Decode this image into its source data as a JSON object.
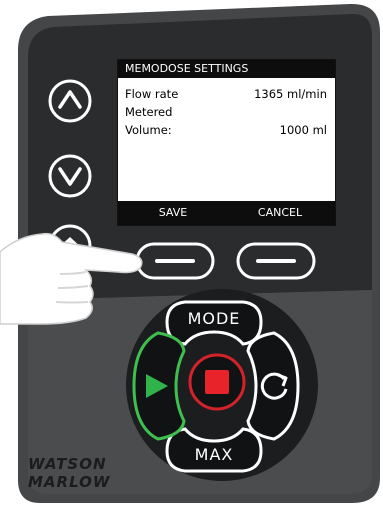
{
  "screen": {
    "title": "MEMODOSE SETTINGS",
    "rows": [
      {
        "label": "Flow rate",
        "value": "1365 ml/min"
      },
      {
        "label": "Metered",
        "value": ""
      },
      {
        "label": "Volume:",
        "value": "1000 ml"
      }
    ],
    "softkeys": {
      "left": "SAVE",
      "right": "CANCEL"
    }
  },
  "keypad": {
    "mode_label": "MODE",
    "max_label": "MAX",
    "run_button": {
      "icon": "play-icon",
      "color": "#2fb34a"
    },
    "stop_button": {
      "icon": "stop-icon",
      "color": "#e8232a"
    },
    "direction_button": {
      "icon": "rotate-direction-icon"
    },
    "up_button": {
      "icon": "up-chevron-icon"
    },
    "down_button": {
      "icon": "down-chevron-icon"
    },
    "home_button": {
      "icon": "home-icon"
    }
  },
  "brand": {
    "line1": "WATSON",
    "line2": "MARLOW"
  },
  "colors": {
    "panel": "#2d2f31",
    "frame": "#3f4143",
    "button_ring": "#ffffff",
    "run_glow": "#3fbf4f",
    "stop_ring": "#d3232a"
  }
}
